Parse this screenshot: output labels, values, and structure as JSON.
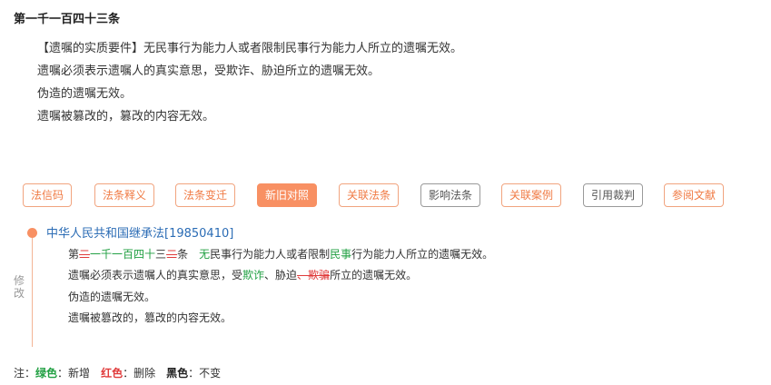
{
  "article": {
    "title": "第一千一百四十三条",
    "paragraphs": [
      "【遗嘱的实质要件】无民事行为能力人或者限制民事行为能力人所立的遗嘱无效。",
      "遗嘱必须表示遗嘱人的真实意思，受欺诈、胁迫所立的遗嘱无效。",
      "伪造的遗嘱无效。",
      "遗嘱被篡改的，篡改的内容无效。"
    ]
  },
  "tabs": [
    {
      "label": "法信码",
      "style": "orange"
    },
    {
      "label": "法条释义",
      "style": "orange"
    },
    {
      "label": "法条变迁",
      "style": "orange"
    },
    {
      "label": "新旧对照",
      "style": "active"
    },
    {
      "label": "关联法条",
      "style": "orange"
    },
    {
      "label": "影响法条",
      "style": "gray"
    },
    {
      "label": "关联案例",
      "style": "orange"
    },
    {
      "label": "引用裁判",
      "style": "gray"
    },
    {
      "label": "参阅文献",
      "style": "orange"
    }
  ],
  "comparison": {
    "law_title": "中华人民共和国继承法[19850410]",
    "side_label": "修改",
    "line1": {
      "t1": "第",
      "r1": "二",
      "g1": "一千一百四十",
      "t2": "三",
      "r2": "二",
      "t3": "条　",
      "g2": "无",
      "t4": "民事",
      "g3": "行为能力人或者限制",
      "g4": "民事",
      "t5": "行为能力人所立的遗嘱无效。"
    },
    "line2": {
      "t1": "遗嘱必须表示遗嘱人的真实意思，受",
      "g1": "欺诈",
      "t2": "、胁迫",
      "r1": "、欺骗",
      "t3": "所立的遗嘱无效。"
    },
    "line3": "伪造的遗嘱无效。",
    "line4": "遗嘱被篡改的，篡改的内容无效。"
  },
  "legend": {
    "prefix": "注：",
    "green_key": "绿色",
    "green_val": "：新增",
    "red_key": "红色",
    "red_val": "：删除",
    "black_key": "黑色",
    "black_val": "：不变"
  },
  "colors": {
    "accent": "#f89063",
    "added": "#22a043",
    "deleted": "#e03b3b",
    "link": "#2b6cb5"
  }
}
